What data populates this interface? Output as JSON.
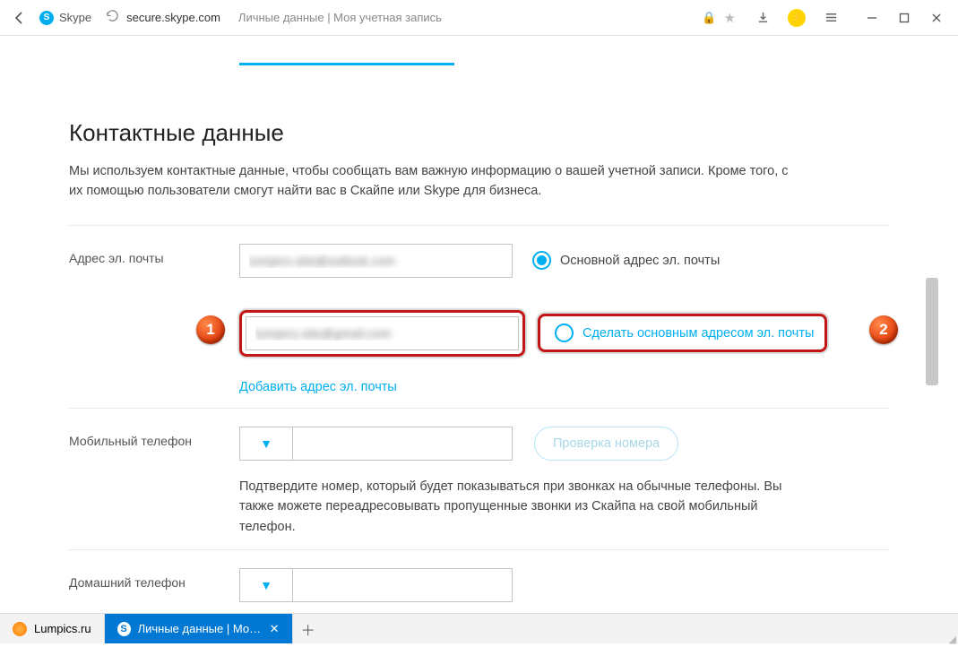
{
  "browser": {
    "back_tab_title": "Skype",
    "url_domain": "secure.skype.com",
    "url_path_title": "Личные данные | Моя учетная запись"
  },
  "section": {
    "title": "Контактные данные",
    "description": "Мы используем контактные данные, чтобы сообщать вам важную информацию о вашей учетной записи. Кроме того, с их помощью пользователи смогут найти вас в Скайпе или Skype для бизнеса."
  },
  "email": {
    "label": "Адрес эл. почты",
    "primary_value": "lumpics.site@outlook.com",
    "primary_radio": "Основной адрес эл. почты",
    "secondary_value": "lumpics.site@gmail.com",
    "make_primary": "Сделать основным адресом эл. почты",
    "add_link": "Добавить адрес эл. почты"
  },
  "mobile": {
    "label": "Мобильный телефон",
    "verify_button": "Проверка номера",
    "hint": "Подтвердите номер, который будет показываться при звонках на обычные телефоны. Вы также можете переадресовывать пропущенные звонки из Скайпа на свой мобильный телефон."
  },
  "home_phone": {
    "label": "Домашний телефон"
  },
  "steps": {
    "one": "1",
    "two": "2"
  },
  "tabs": {
    "t1": "Lumpics.ru",
    "t2": "Личные данные | Моя уч"
  }
}
